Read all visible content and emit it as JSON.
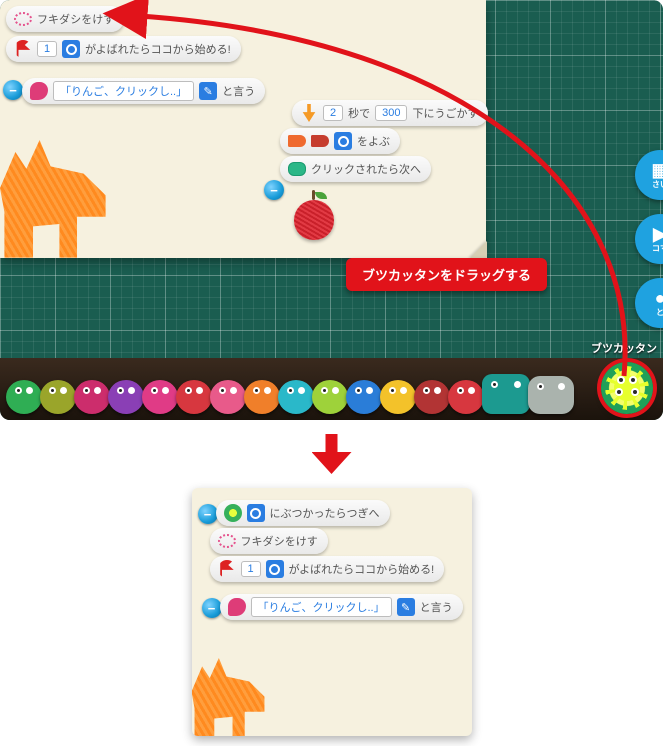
{
  "blocks_top": {
    "erase_bubble": "フキダシをけす",
    "on_call_value": "1",
    "on_call_text": "がよばれたらココから始める!",
    "say_text": "「りんご、クリックし..」",
    "say_suffix": "と言う",
    "move_prefix": "",
    "move_seconds": "2",
    "move_sec_label": "秒で",
    "move_amount": "300",
    "move_suffix": "下にうごかす",
    "call_suffix": "をよぶ",
    "click_next": "クリックされたら次へ"
  },
  "annotation": {
    "callout": "ブツカッタンをドラッグする",
    "star_label": "ブツカッタン"
  },
  "side_tabs": {
    "t1": "さい",
    "t2": "コマ",
    "t3": "と"
  },
  "blocks_bottom": {
    "collide_next": "にぶつかったらつぎへ",
    "erase_bubble": "フキダシをけす",
    "on_call_value": "1",
    "on_call_text": "がよばれたらココから始める!",
    "say_text": "「りんご、クリックし..」",
    "say_suffix": "と言う"
  }
}
